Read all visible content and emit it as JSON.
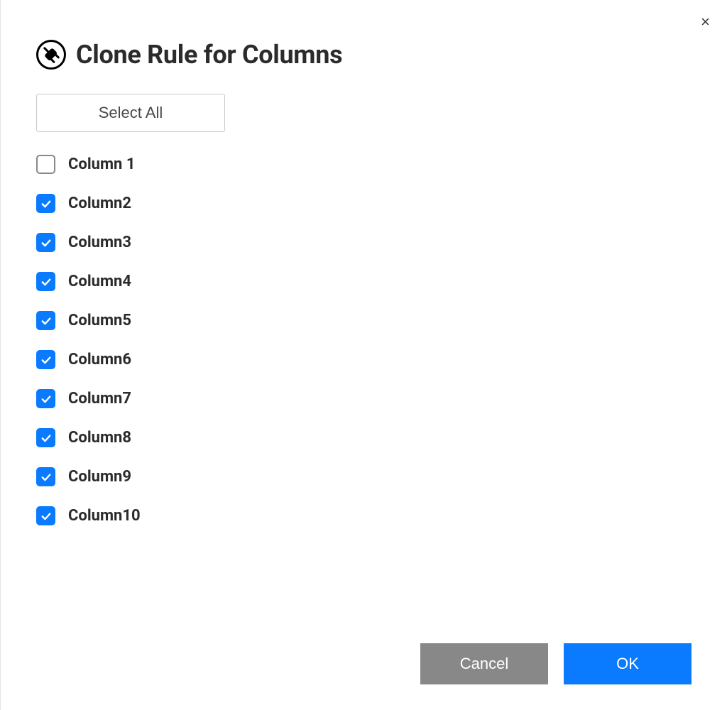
{
  "dialog": {
    "title": "Clone Rule for Columns",
    "select_all_label": "Select All",
    "close_label": "×"
  },
  "columns": [
    {
      "label": "Column 1",
      "checked": false
    },
    {
      "label": "Column2",
      "checked": true
    },
    {
      "label": "Column3",
      "checked": true
    },
    {
      "label": "Column4",
      "checked": true
    },
    {
      "label": "Column5",
      "checked": true
    },
    {
      "label": "Column6",
      "checked": true
    },
    {
      "label": "Column7",
      "checked": true
    },
    {
      "label": "Column8",
      "checked": true
    },
    {
      "label": "Column9",
      "checked": true
    },
    {
      "label": "Column10",
      "checked": true
    }
  ],
  "footer": {
    "cancel_label": "Cancel",
    "ok_label": "OK"
  },
  "colors": {
    "accent_blue": "#0a7aff",
    "cancel_gray": "#888888"
  }
}
